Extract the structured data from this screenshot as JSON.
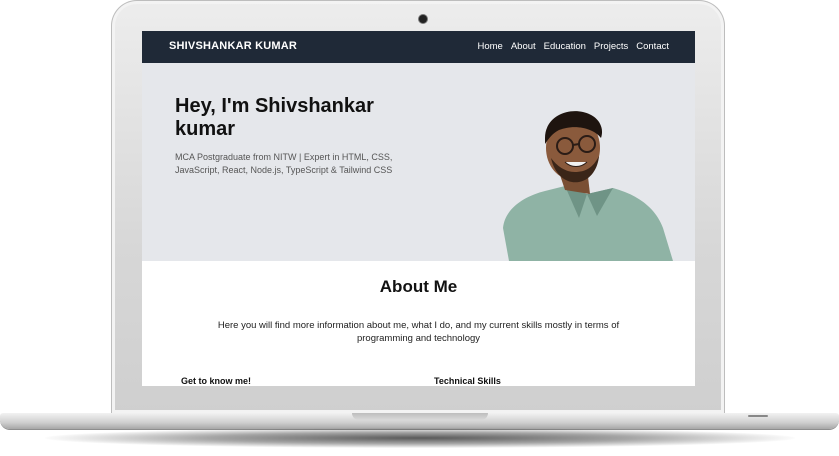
{
  "brand": "SHIVSHANKAR KUMAR",
  "nav": {
    "items": [
      {
        "label": "Home"
      },
      {
        "label": "About"
      },
      {
        "label": "Education"
      },
      {
        "label": "Projects"
      },
      {
        "label": "Contact"
      }
    ]
  },
  "hero": {
    "title": "Hey, I'm Shivshankar kumar",
    "subtitle": "MCA Postgraduate from NITW | Expert in HTML, CSS, JavaScript, React, Node.js, TypeScript & Tailwind CSS"
  },
  "about": {
    "title": "About Me",
    "description": "Here you will find more information about me, what I do, and my current skills mostly in terms of programming and technology",
    "col1_heading": "Get to know me!",
    "col2_heading": "Technical Skills"
  },
  "colors": {
    "nav_bg": "#1f2937",
    "hero_bg": "#e5e7eb",
    "text_dark": "#111111",
    "shirt": "#8fb3a5",
    "skin": "#8a5a3c"
  },
  "icons": {
    "camera": "camera-icon"
  }
}
